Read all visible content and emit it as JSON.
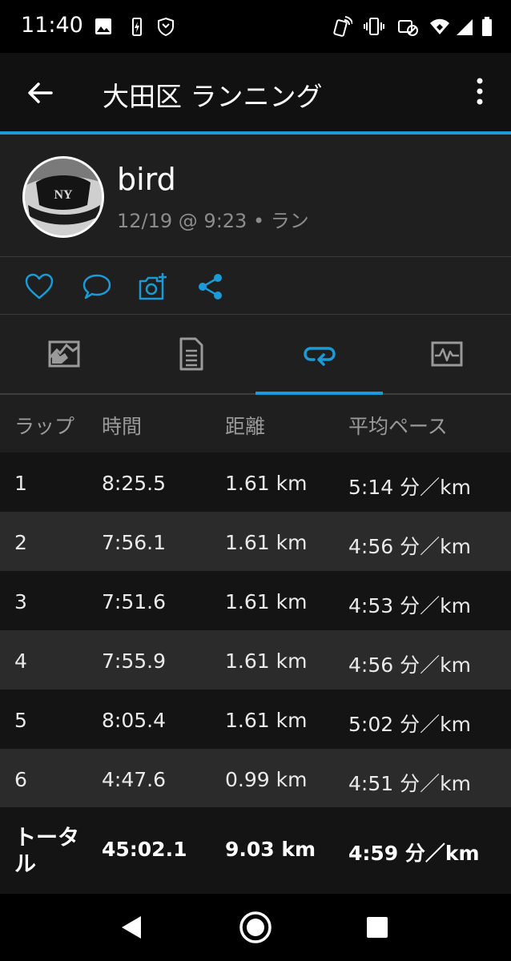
{
  "status_bar": {
    "time": "11:40"
  },
  "app_bar": {
    "title": "大田区 ランニング"
  },
  "profile": {
    "name": "bird",
    "meta": "12/19 @ 9:23 • ラン"
  },
  "laps": {
    "headers": {
      "lap": "ラップ",
      "time": "時間",
      "distance": "距離",
      "pace": "平均ペース"
    },
    "rows": [
      {
        "lap": "1",
        "time": "8:25.5",
        "distance": "1.61 km",
        "pace": "5:14 分／km"
      },
      {
        "lap": "2",
        "time": "7:56.1",
        "distance": "1.61 km",
        "pace": "4:56 分／km"
      },
      {
        "lap": "3",
        "time": "7:51.6",
        "distance": "1.61 km",
        "pace": "4:53 分／km"
      },
      {
        "lap": "4",
        "time": "7:55.9",
        "distance": "1.61 km",
        "pace": "4:56 分／km"
      },
      {
        "lap": "5",
        "time": "8:05.4",
        "distance": "1.61 km",
        "pace": "5:02 分／km"
      },
      {
        "lap": "6",
        "time": "4:47.6",
        "distance": "0.99 km",
        "pace": "4:51 分／km"
      }
    ],
    "total": {
      "label": "トータル",
      "time": "45:02.1",
      "distance": "9.03 km",
      "pace": "4:59 分／km"
    }
  },
  "colors": {
    "accent": "#1a9bd7",
    "background": "#1f1f1f",
    "row_dark": "#141414",
    "row_light": "#2b2b2b"
  }
}
